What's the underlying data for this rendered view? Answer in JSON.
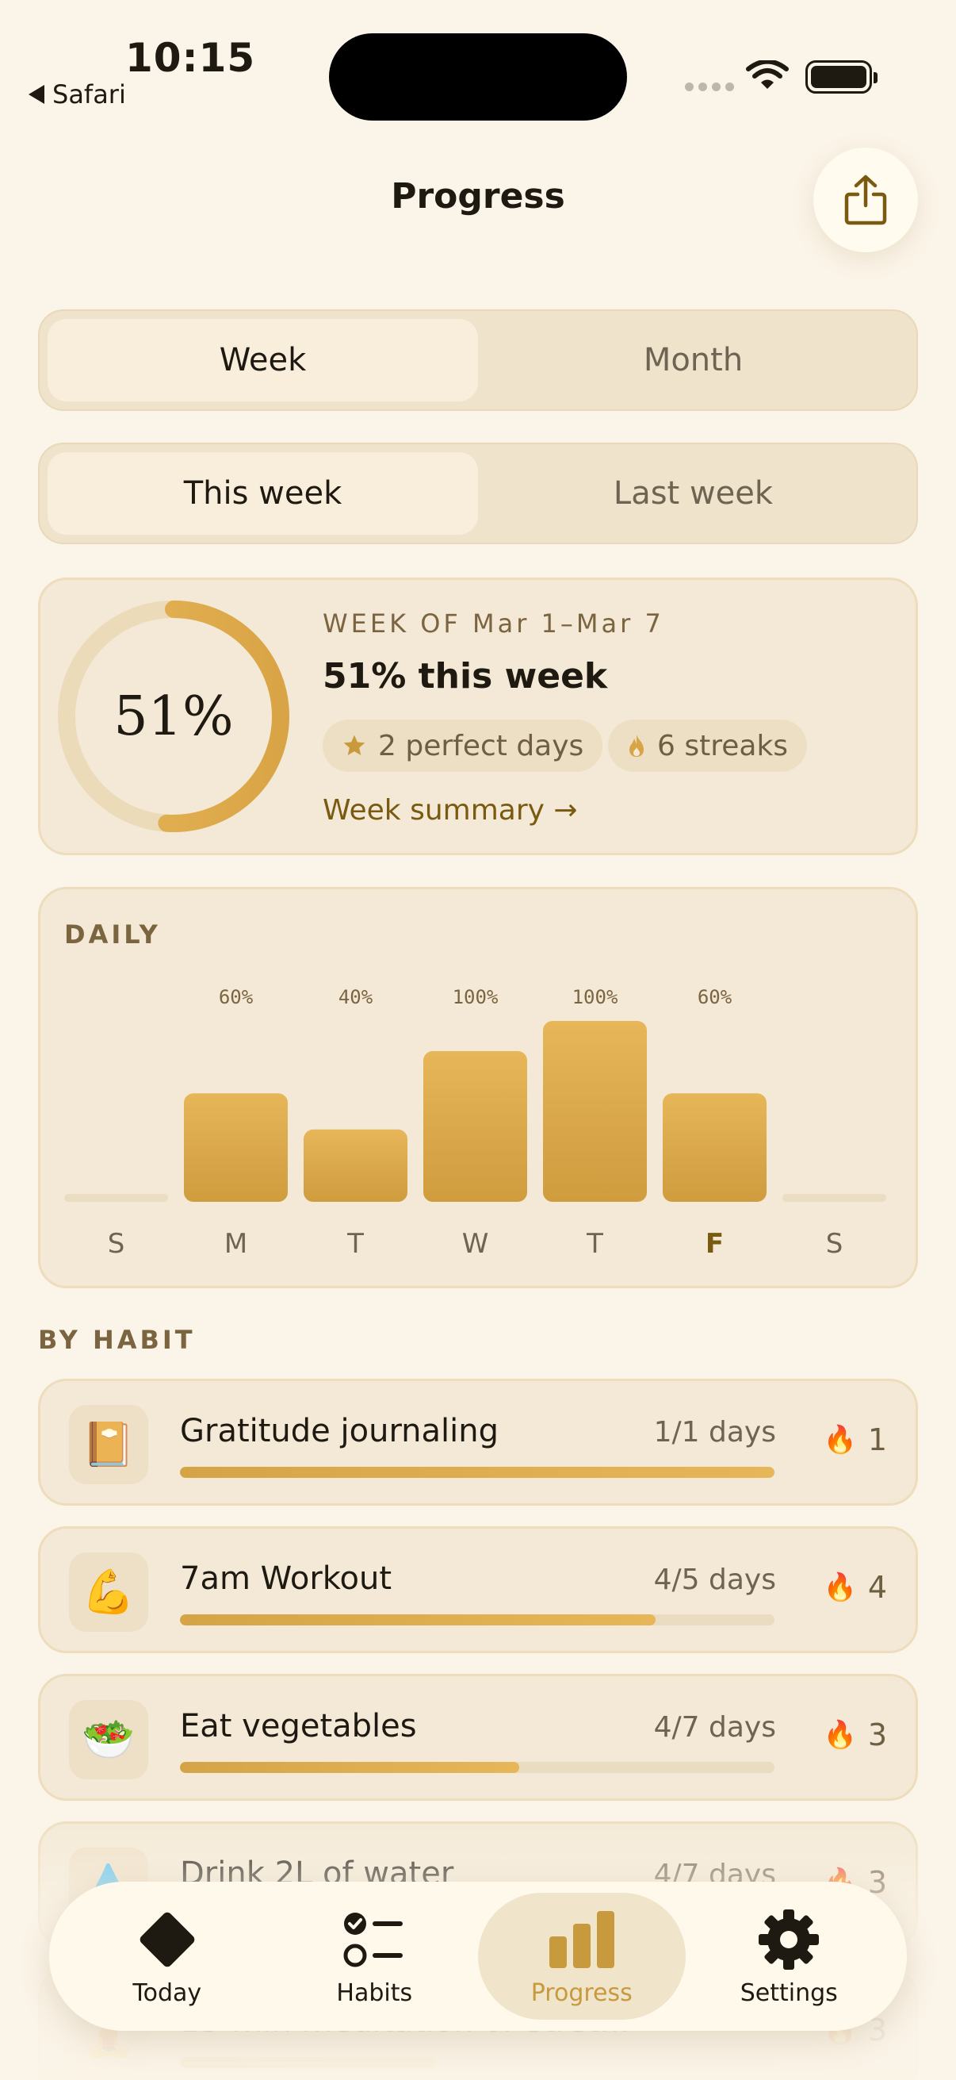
{
  "status_bar": {
    "time": "10:15",
    "back_label": "Safari"
  },
  "header": {
    "title": "Progress",
    "share_icon": "share-icon"
  },
  "range_tabs": [
    {
      "label": "Week",
      "active": true
    },
    {
      "label": "Month",
      "active": false
    }
  ],
  "week_tabs": [
    {
      "label": "This week",
      "active": true
    },
    {
      "label": "Last week",
      "active": false
    }
  ],
  "summary": {
    "ring_label": "51%",
    "ring_value": 0.51,
    "week_of": "WEEK OF Mar 1–Mar 7",
    "headline": "51% this week",
    "perfect_days": "2 perfect days",
    "streaks": "6 streaks",
    "link": "Week summary →"
  },
  "daily": {
    "label": "DAILY",
    "chart_data": {
      "type": "bar",
      "categories": [
        "S",
        "M",
        "T",
        "W",
        "T",
        "F",
        "S"
      ],
      "values": [
        null,
        60,
        40,
        100,
        100,
        60,
        null
      ],
      "value_labels": [
        "",
        "60%",
        "40%",
        "100%",
        "100%",
        "60%",
        ""
      ],
      "highlighted_category_index": 5,
      "ylim": [
        0,
        100
      ]
    }
  },
  "by_habit": {
    "label": "BY HABIT",
    "items": [
      {
        "emoji": "📔",
        "name": "Gratitude journaling",
        "days": "1/1 days",
        "progress": 1.0,
        "streak": "1"
      },
      {
        "emoji": "💪",
        "name": "7am Workout",
        "days": "4/5 days",
        "progress": 0.8,
        "streak": "4"
      },
      {
        "emoji": "🥗",
        "name": "Eat vegetables",
        "days": "4/7 days",
        "progress": 0.57,
        "streak": "3"
      },
      {
        "emoji": "💧",
        "name": "Drink 2L of water",
        "days": "4/7 days",
        "progress": 0.57,
        "streak": "3"
      },
      {
        "emoji": "🧘",
        "name": "15-min meditation or stret...",
        "days": "",
        "progress": 0.43,
        "streak": "3"
      }
    ]
  },
  "tab_bar": [
    {
      "label": "Today",
      "icon": "diamond-icon",
      "active": false
    },
    {
      "label": "Habits",
      "icon": "checklist-icon",
      "active": false
    },
    {
      "label": "Progress",
      "icon": "bar-chart-icon",
      "active": true
    },
    {
      "label": "Settings",
      "icon": "gear-icon",
      "active": false
    }
  ],
  "colors": {
    "accent": "#D9A94E",
    "accent_dark": "#7A5A10",
    "background": "#FBF4E8",
    "card": "#F3E9D6"
  }
}
